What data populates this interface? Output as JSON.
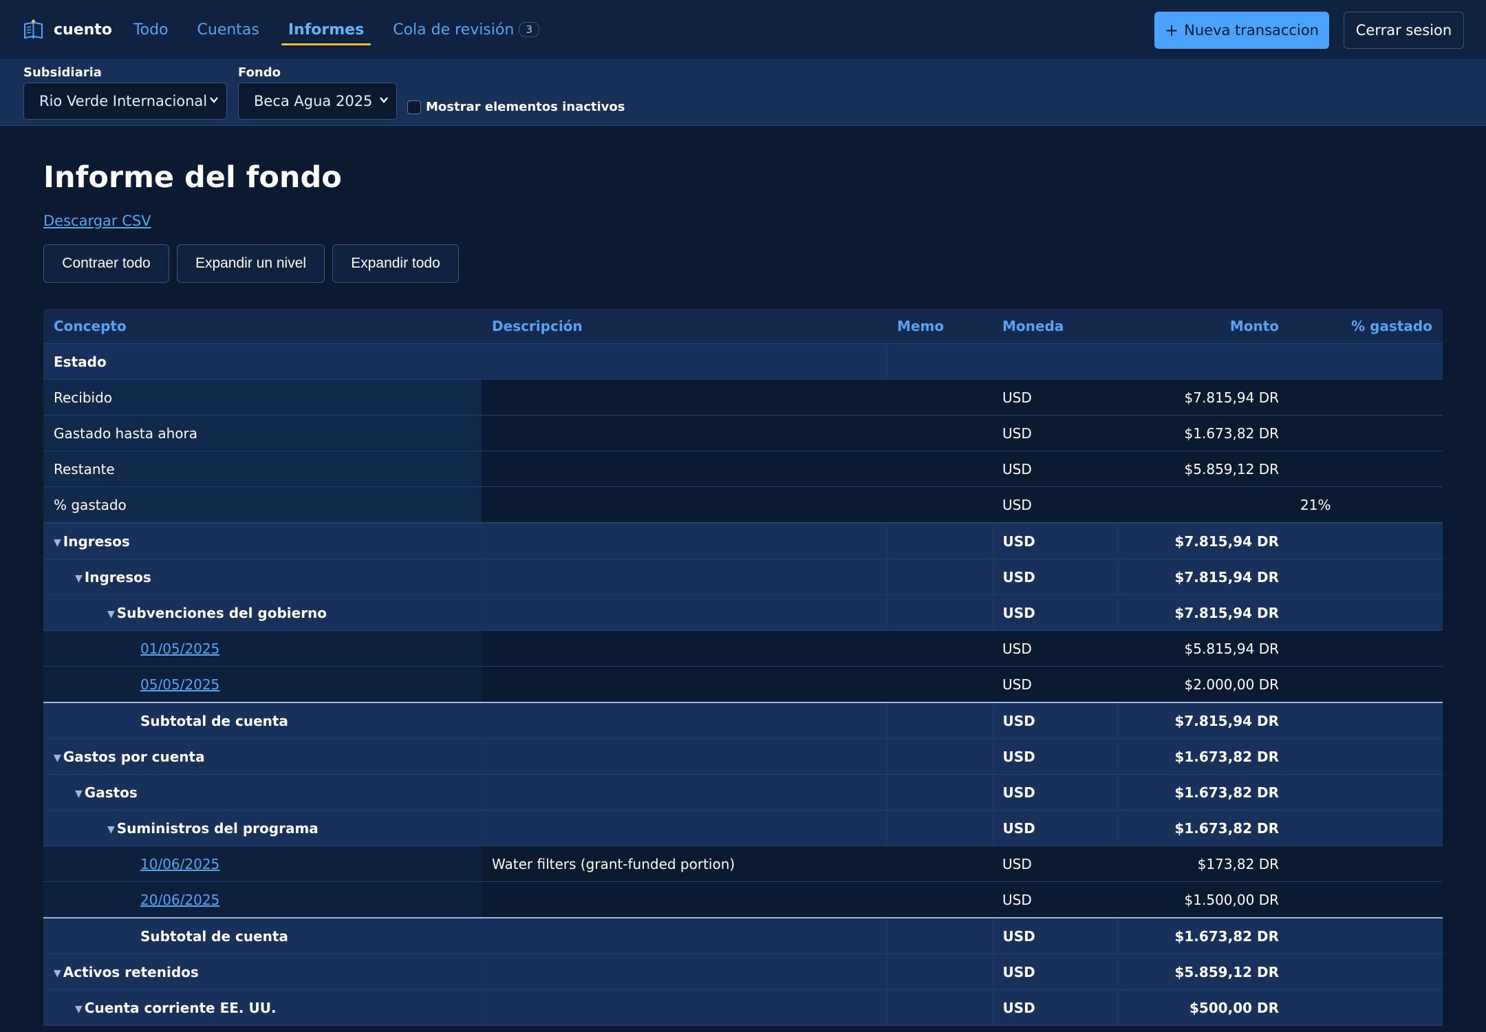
{
  "nav": {
    "brand": "cuento",
    "links": [
      "Todo",
      "Cuentas",
      "Informes",
      "Cola de revisión"
    ],
    "review_count": "3",
    "new_button": "Nueva transaccion",
    "logout_button": "Cerrar sesion"
  },
  "filters": {
    "subsidiary_label": "Subsidiaria",
    "subsidiary_value": "Rio Verde Internacional",
    "fund_label": "Fondo",
    "fund_value": "Beca Agua 2025",
    "inactive_label": "Mostrar elementos inactivos"
  },
  "page": {
    "title": "Informe del fondo",
    "csv_link": "Descargar CSV",
    "buttons": [
      "Contraer todo",
      "Expandir un nivel",
      "Expandir todo"
    ]
  },
  "table": {
    "headers": [
      "Concepto",
      "Descripción",
      "Memo",
      "Moneda",
      "Monto",
      "% gastado"
    ],
    "rows": [
      {
        "concept": "Estado",
        "description": "",
        "currency": "",
        "amount": "",
        "pct": ""
      },
      {
        "concept": "Recibido",
        "description": "",
        "currency": "USD",
        "amount": "$7.815,94 DR",
        "pct": ""
      },
      {
        "concept": "Gastado hasta ahora",
        "description": "",
        "currency": "USD",
        "amount": "$1.673,82 DR",
        "pct": ""
      },
      {
        "concept": "Restante",
        "description": "",
        "currency": "USD",
        "amount": "$5.859,12 DR",
        "pct": ""
      },
      {
        "concept": "% gastado",
        "description": "",
        "currency": "USD",
        "amount": "",
        "pct": "21%"
      },
      {
        "concept": "Ingresos",
        "description": "",
        "currency": "USD",
        "amount": "$7.815,94 DR",
        "pct": ""
      },
      {
        "concept": "Ingresos",
        "description": "",
        "currency": "USD",
        "amount": "$7.815,94 DR",
        "pct": ""
      },
      {
        "concept": "Subvenciones del gobierno",
        "description": "",
        "currency": "USD",
        "amount": "$7.815,94 DR",
        "pct": ""
      },
      {
        "concept": "01/05/2025",
        "description": "",
        "currency": "USD",
        "amount": "$5.815,94 DR",
        "pct": ""
      },
      {
        "concept": "05/05/2025",
        "description": "",
        "currency": "USD",
        "amount": "$2.000,00 DR",
        "pct": ""
      },
      {
        "concept": "Subtotal de cuenta",
        "description": "",
        "currency": "USD",
        "amount": "$7.815,94 DR",
        "pct": ""
      },
      {
        "concept": "Gastos por cuenta",
        "description": "",
        "currency": "USD",
        "amount": "$1.673,82 DR",
        "pct": ""
      },
      {
        "concept": "Gastos",
        "description": "",
        "currency": "USD",
        "amount": "$1.673,82 DR",
        "pct": ""
      },
      {
        "concept": "Suministros del programa",
        "description": "",
        "currency": "USD",
        "amount": "$1.673,82 DR",
        "pct": ""
      },
      {
        "concept": "10/06/2025",
        "description": "Water filters (grant-funded portion)",
        "currency": "USD",
        "amount": "$173,82 DR",
        "pct": ""
      },
      {
        "concept": "20/06/2025",
        "description": "",
        "currency": "USD",
        "amount": "$1.500,00 DR",
        "pct": ""
      },
      {
        "concept": "Subtotal de cuenta",
        "description": "",
        "currency": "USD",
        "amount": "$1.673,82 DR",
        "pct": ""
      },
      {
        "concept": "Activos retenidos",
        "description": "",
        "currency": "USD",
        "amount": "$5.859,12 DR",
        "pct": ""
      },
      {
        "concept": "Cuenta corriente EE. UU.",
        "description": "",
        "currency": "USD",
        "amount": "$500,00 DR",
        "pct": ""
      }
    ]
  }
}
